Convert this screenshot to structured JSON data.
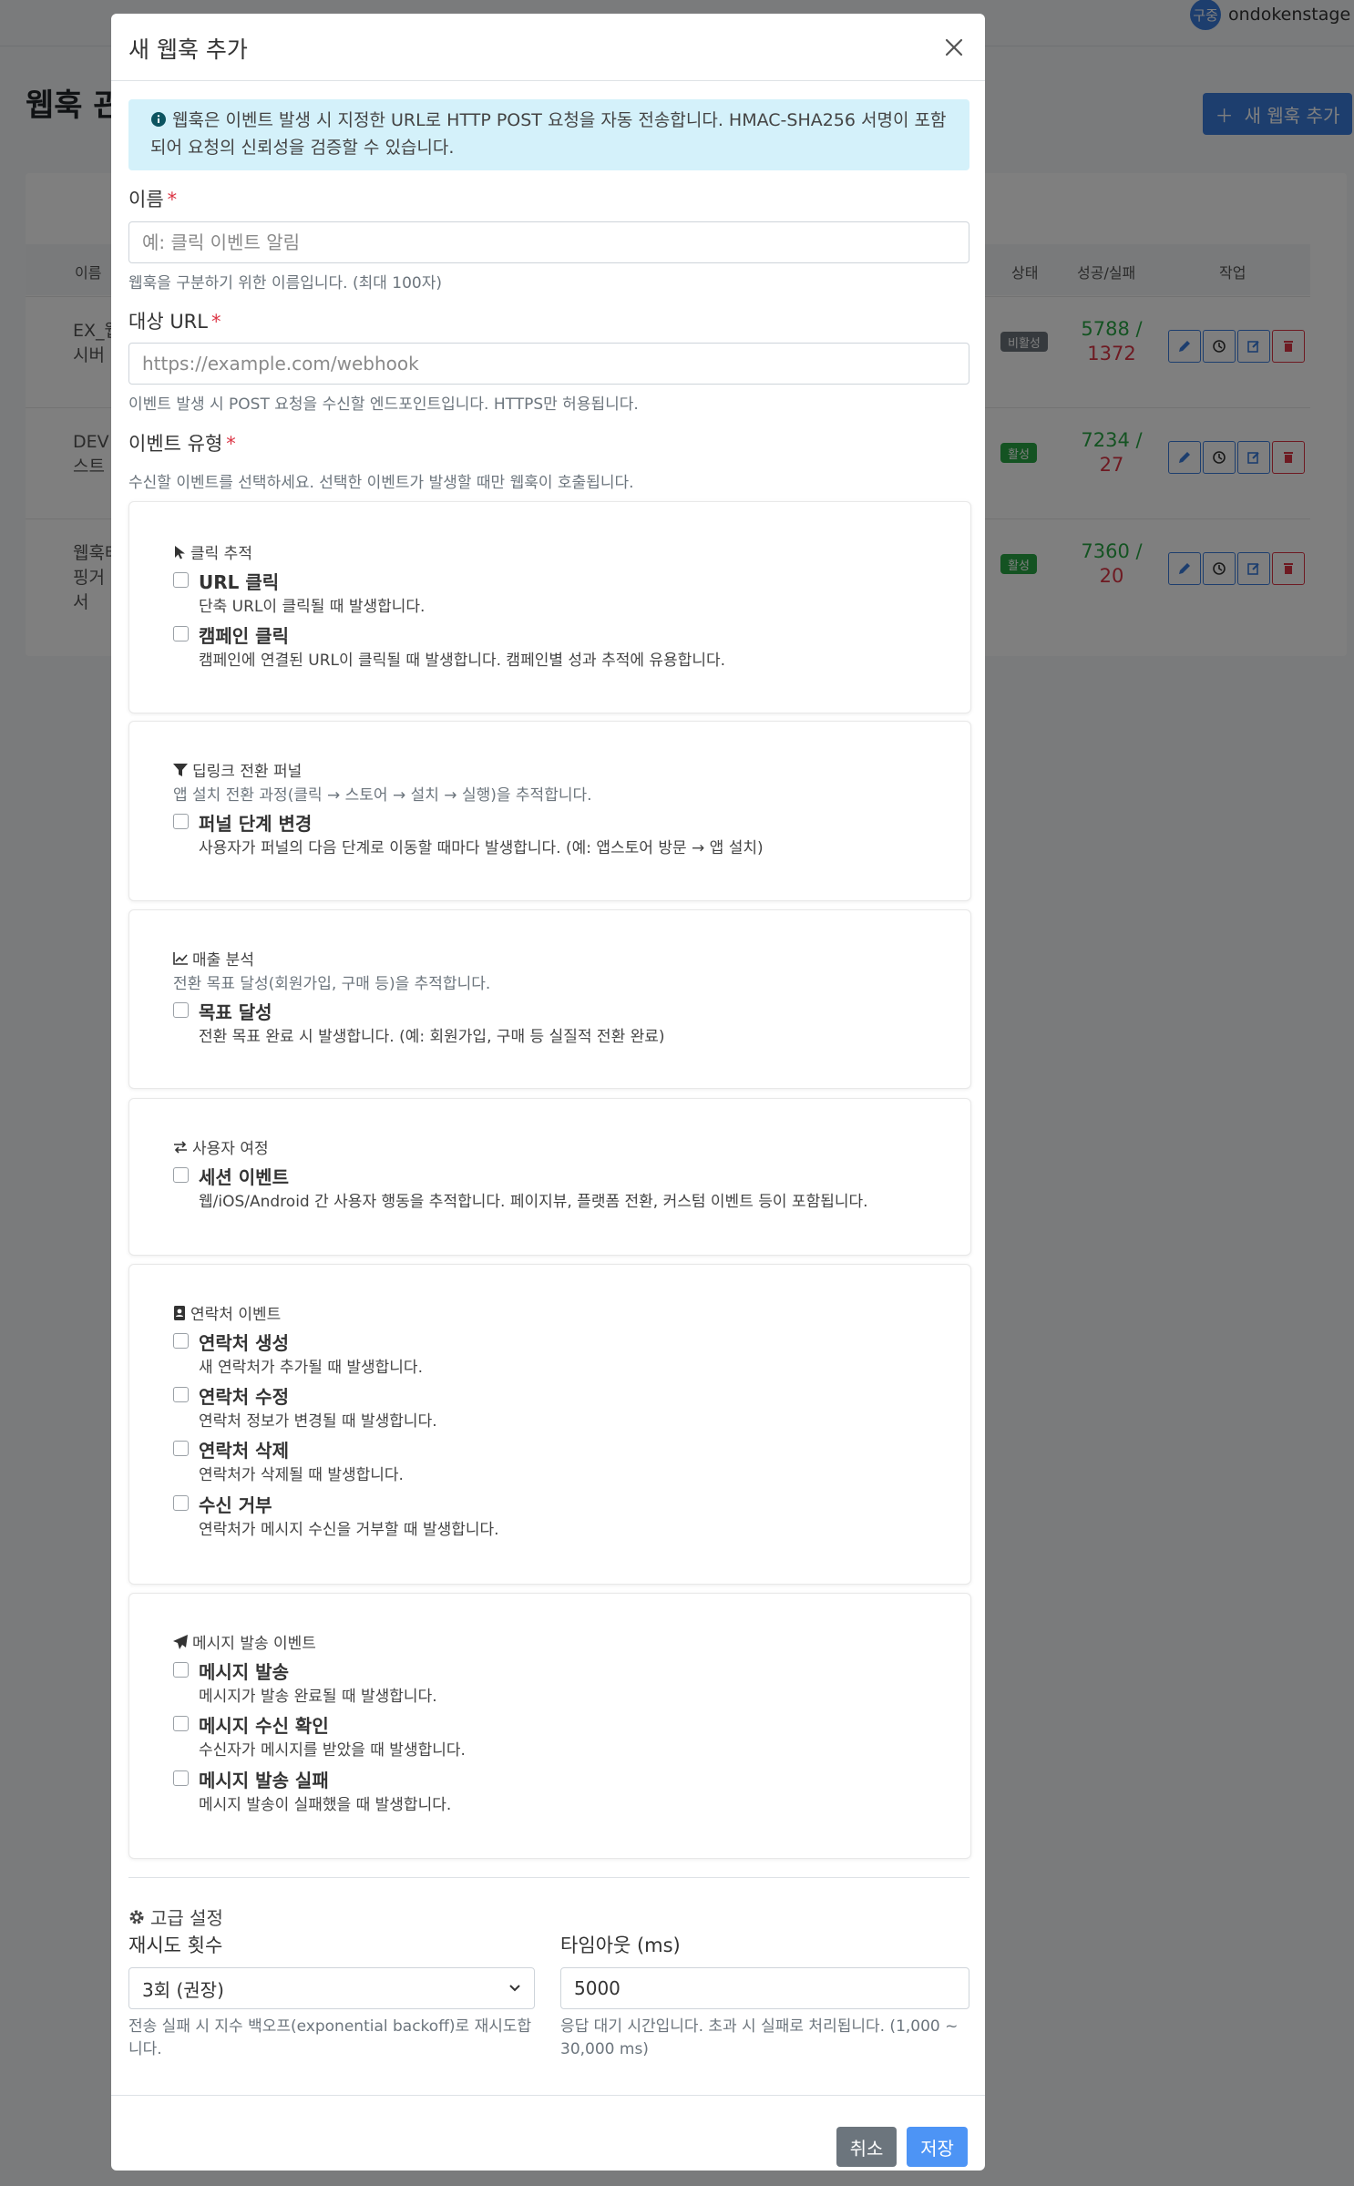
{
  "header": {
    "user_badge": "구중",
    "user_name": "ondokenstage"
  },
  "background": {
    "page_title": "웹훅 관",
    "add_button_label": "새 웹훅 추가",
    "columns": {
      "name": "이름",
      "status": "상태",
      "success_fail": "성공/실패",
      "actions": "작업"
    },
    "rows": [
      {
        "name": "EX_웹 시버",
        "status": "비활성",
        "status_color": "#6c757d",
        "success": "5788 /",
        "fail": "1372"
      },
      {
        "name": "DEV 스트",
        "status": "활성",
        "status_color": "#28a745",
        "success": "7234 /",
        "fail": "27"
      },
      {
        "name": "웹훅테 핑거 발서",
        "status": "활성",
        "status_color": "#28a745",
        "success": "7360 /",
        "fail": "20"
      }
    ]
  },
  "modal": {
    "title": "새 웹훅 추가",
    "info": "웹훅은 이벤트 발생 시 지정한 URL로 HTTP POST 요청을 자동 전송합니다. HMAC-SHA256 서명이 포함되어 요청의 신뢰성을 검증할 수 있습니다.",
    "name_field": {
      "label": "이름",
      "placeholder": "예: 클릭 이벤트 알림",
      "help": "웹훅을 구분하기 위한 이름입니다. (최대 100자)"
    },
    "url_field": {
      "label": "대상 URL",
      "placeholder": "https://example.com/webhook",
      "help": "이벤트 발생 시 POST 요청을 수신할 엔드포인트입니다. HTTPS만 허용됩니다."
    },
    "events": {
      "label": "이벤트 유형",
      "help": "수신할 이벤트를 선택하세요. 선택한 이벤트가 발생할 때만 웹훅이 호출됩니다.",
      "groups": [
        {
          "title": "클릭 추적",
          "icon": "cursor-icon",
          "options": [
            {
              "name": "URL 클릭",
              "desc": "단축 URL이 클릭될 때 발생합니다."
            },
            {
              "name": "캠페인 클릭",
              "desc": "캠페인에 연결된 URL이 클릭될 때 발생합니다. 캠페인별 성과 추적에 유용합니다."
            }
          ]
        },
        {
          "title": "딥링크 전환 퍼널",
          "icon": "filter-icon",
          "desc": "앱 설치 전환 과정(클릭 → 스토어 → 설치 → 실행)을 추적합니다.",
          "options": [
            {
              "name": "퍼널 단계 변경",
              "desc": "사용자가 퍼널의 다음 단계로 이동할 때마다 발생합니다. (예: 앱스토어 방문 → 앱 설치)"
            }
          ]
        },
        {
          "title": "매출 분석",
          "icon": "line-chart-icon",
          "desc": "전환 목표 달성(회원가입, 구매 등)을 추적합니다.",
          "options": [
            {
              "name": "목표 달성",
              "desc": "전환 목표 완료 시 발생합니다. (예: 회원가입, 구매 등 실질적 전환 완료)"
            }
          ]
        },
        {
          "title": "사용자 여정",
          "icon": "exchange-icon",
          "options": [
            {
              "name": "세션 이벤트",
              "desc": "웹/iOS/Android 간 사용자 행동을 추적합니다. 페이지뷰, 플랫폼 전환, 커스텀 이벤트 등이 포함됩니다."
            }
          ]
        },
        {
          "title": "연락처 이벤트",
          "icon": "contact-book-icon",
          "options": [
            {
              "name": "연락처 생성",
              "desc": "새 연락처가 추가될 때 발생합니다."
            },
            {
              "name": "연락처 수정",
              "desc": "연락처 정보가 변경될 때 발생합니다."
            },
            {
              "name": "연락처 삭제",
              "desc": "연락처가 삭제될 때 발생합니다."
            },
            {
              "name": "수신 거부",
              "desc": "연락처가 메시지 수신을 거부할 때 발생합니다."
            }
          ]
        },
        {
          "title": "메시지 발송 이벤트",
          "icon": "paper-plane-icon",
          "options": [
            {
              "name": "메시지 발송",
              "desc": "메시지가 발송 완료될 때 발생합니다."
            },
            {
              "name": "메시지 수신 확인",
              "desc": "수신자가 메시지를 받았을 때 발생합니다."
            },
            {
              "name": "메시지 발송 실패",
              "desc": "메시지 발송이 실패했을 때 발생합니다."
            }
          ]
        }
      ]
    },
    "advanced": {
      "title": "고급 설정",
      "retry": {
        "label": "재시도 횟수",
        "value": "3회 (권장)",
        "help": "전송 실패 시 지수 백오프(exponential backoff)로 재시도합니다."
      },
      "timeout": {
        "label": "타임아웃 (ms)",
        "value": "5000",
        "help": "응답 대기 시간입니다. 초과 시 실패로 처리됩니다. (1,000 ~ 30,000 ms)"
      }
    },
    "footer": {
      "cancel": "취소",
      "save": "저장"
    }
  }
}
